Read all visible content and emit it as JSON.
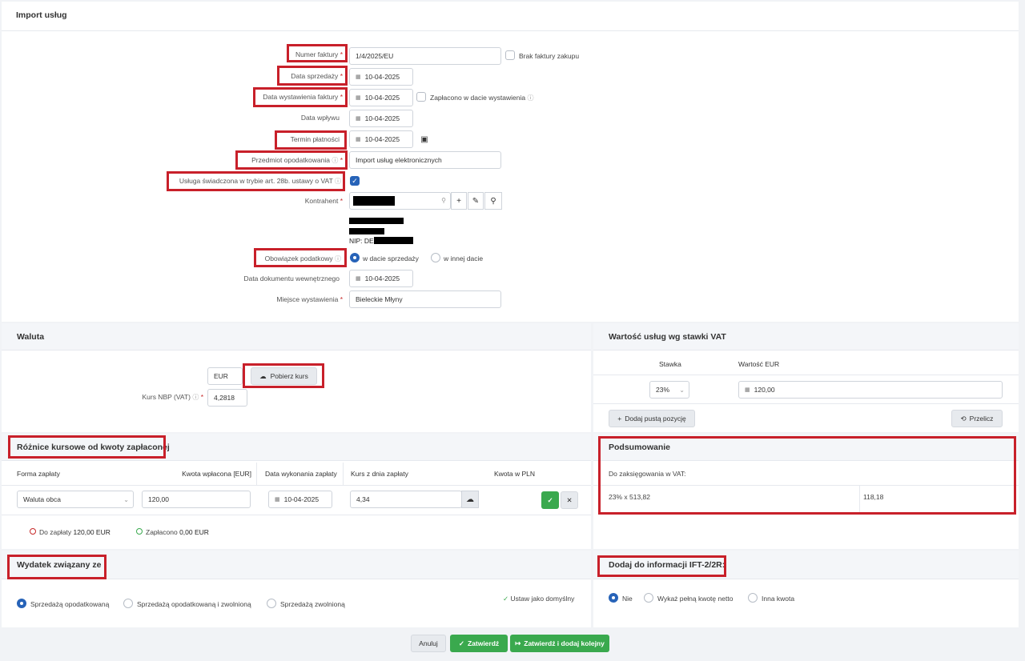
{
  "page": {
    "title": "Import usług"
  },
  "form": {
    "invoice_number": {
      "label": "Numer faktury",
      "required": "*",
      "value": "1/4/2025/EU",
      "no_invoice_label": "Brak faktury zakupu"
    },
    "sale_date": {
      "label": "Data sprzedaży",
      "required": "*",
      "value": "10-04-2025"
    },
    "issue_date": {
      "label": "Data wystawienia faktury",
      "required": "*",
      "value": "10-04-2025",
      "paid_label": "Zapłacono w dacie wystawienia"
    },
    "receipt_date": {
      "label": "Data wpływu",
      "value": "10-04-2025"
    },
    "payment_term": {
      "label": "Termin płatności",
      "value": "10-04-2025"
    },
    "tax_subject": {
      "label": "Przedmiot opodatkowania",
      "required": "*",
      "value": "Import usług elektronicznych"
    },
    "art28b": {
      "label": "Usługa świadczona w trybie art. 28b. ustawy o VAT"
    },
    "contractor": {
      "label": "Kontrahent",
      "required": "*",
      "nip_prefix": "NIP: DE"
    },
    "tax_obligation": {
      "label": "Obowiązek podatkowy",
      "option_sale": "w dacie sprzedaży",
      "option_other": "w innej dacie"
    },
    "internal_doc_date": {
      "label": "Data dokumentu wewnętrznego",
      "value": "10-04-2025"
    },
    "issue_place": {
      "label": "Miejsce wystawienia",
      "required": "*",
      "value": "Bieleckie Młyny"
    }
  },
  "currency": {
    "title": "Waluta",
    "code": "EUR",
    "fetch_rate_label": "Pobierz kurs",
    "rate_label": "Kurs NBP (VAT)",
    "required": "*",
    "rate_value": "4,2818"
  },
  "vat_values": {
    "title": "Wartość usług wg stawki VAT",
    "col_rate": "Stawka",
    "col_value": "Wartość EUR",
    "rate": "23%",
    "value": "120,00",
    "add_row_label": "Dodaj pustą pozycję",
    "recalc_label": "Przelicz"
  },
  "exchange_diff": {
    "title": "Różnice kursowe od kwoty zapłaconej",
    "col_form": "Forma zapłaty",
    "col_amount": "Kwota wpłacona [EUR]",
    "col_date": "Data wykonania zapłaty",
    "col_rate": "Kurs z dnia zapłaty",
    "col_pln": "Kwota w PLN",
    "form": "Waluta obca",
    "amount": "120,00",
    "date": "10-04-2025",
    "rate": "4,34",
    "to_pay_label": "Do zapłaty",
    "to_pay_value": "120,00 EUR",
    "paid_label": "Zapłacono",
    "paid_value": "0,00 EUR"
  },
  "summary": {
    "title": "Podsumowanie",
    "subtitle": "Do zaksięgowania w VAT:",
    "formula": "23% x 513,82",
    "result": "118,18"
  },
  "expense": {
    "title": "Wydatek związany ze",
    "opt1": "Sprzedażą opodatkowaną",
    "opt2": "Sprzedażą opodatkowaną i zwolnioną",
    "opt3": "Sprzedażą zwolnioną",
    "set_default": "Ustaw jako domyślny"
  },
  "ift": {
    "title": "Dodaj do informacji IFT-2/2R:",
    "opt1": "Nie",
    "opt2": "Wykaż pełną kwotę netto",
    "opt3": "Inna kwota"
  },
  "footer": {
    "cancel": "Anuluj",
    "confirm": "Zatwierdź",
    "confirm_add": "Zatwierdź i dodaj kolejny"
  },
  "colors": {
    "accent_blue": "#2763b8",
    "green": "#3aa94e",
    "highlight_red": "#c8202a"
  }
}
